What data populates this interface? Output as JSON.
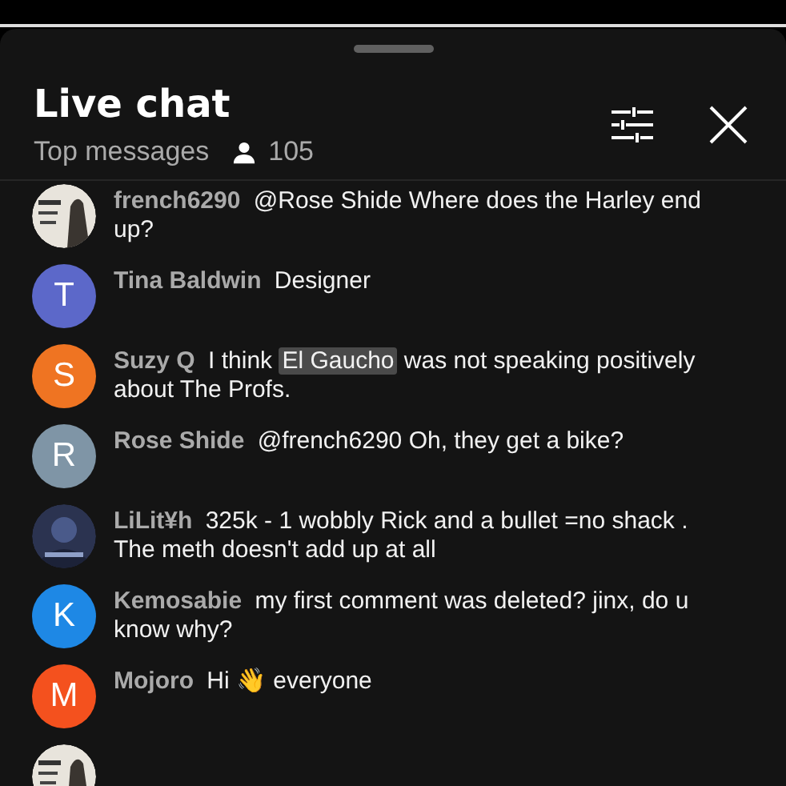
{
  "header": {
    "title": "Live chat",
    "filter": "Top messages",
    "viewer_count": "105"
  },
  "messages": [
    {
      "avatar": {
        "kind": "picture"
      },
      "author": "french6290",
      "text": [
        {
          "text": "@Rose Shide Where does the Harley end up?",
          "highlighted": false
        }
      ]
    },
    {
      "avatar": {
        "kind": "letter",
        "letter": "T",
        "color": "#5c68c9"
      },
      "author": "Tina Baldwin",
      "text": [
        {
          "text": "Designer",
          "highlighted": false
        }
      ]
    },
    {
      "avatar": {
        "kind": "letter",
        "letter": "S",
        "color": "#ef7422"
      },
      "author": "Suzy Q",
      "text": [
        {
          "text": "I think ",
          "highlighted": false
        },
        {
          "text": "El Gaucho",
          "highlighted": true
        },
        {
          "text": " was not speaking positively about The Profs.",
          "highlighted": false
        }
      ]
    },
    {
      "avatar": {
        "kind": "letter",
        "letter": "R",
        "color": "#7f95a6"
      },
      "author": "Rose Shide",
      "text": [
        {
          "text": "@french6290 Oh, they get a bike?",
          "highlighted": false
        }
      ]
    },
    {
      "avatar": {
        "kind": "picture"
      },
      "author": "LiLit¥h",
      "text": [
        {
          "text": "325k - 1 wobbly Rick and a bullet =no shack . The meth doesn't add up at all",
          "highlighted": false
        }
      ]
    },
    {
      "avatar": {
        "kind": "letter",
        "letter": "K",
        "color": "#1e88e5"
      },
      "author": "Kemosabie",
      "text": [
        {
          "text": "my first comment was deleted? jinx, do u know why?",
          "highlighted": false
        }
      ]
    },
    {
      "avatar": {
        "kind": "letter",
        "letter": "M",
        "color": "#f4511e"
      },
      "author": "Mojoro",
      "text": [
        {
          "text": "Hi 👋 everyone",
          "highlighted": false
        }
      ]
    },
    {
      "avatar": {
        "kind": "picture"
      }
    }
  ]
}
